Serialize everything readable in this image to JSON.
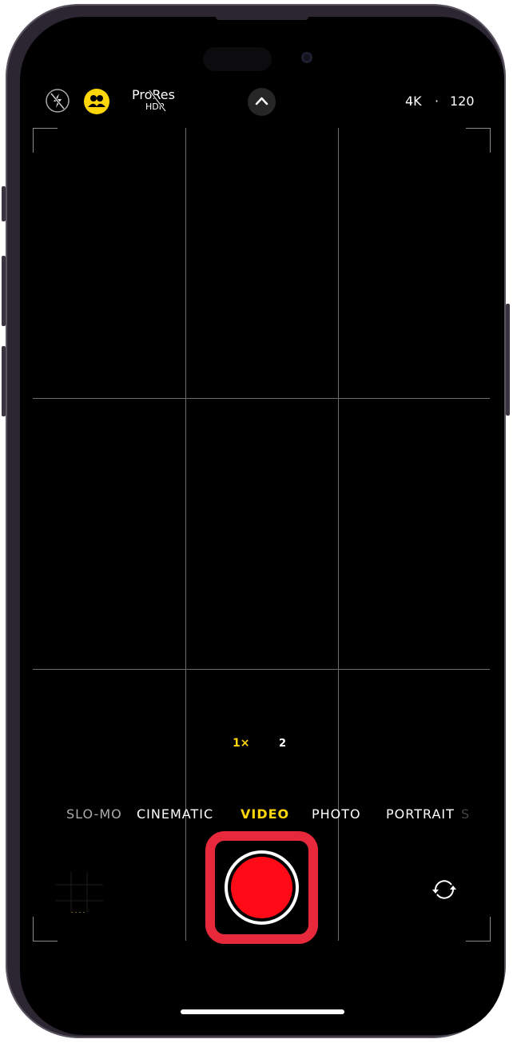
{
  "top_bar": {
    "flash": "flash-off-icon",
    "cinematic_icon": "people-icon",
    "prores_label": "ProRes",
    "hdr_label": "HDR",
    "resolution": "4K",
    "separator": "·",
    "frame_rate": "120"
  },
  "zoom": {
    "options": [
      "1×",
      "2"
    ],
    "selected": "1×"
  },
  "modes": {
    "items": [
      "SLO-MO",
      "CINEMATIC",
      "VIDEO",
      "PHOTO",
      "PORTRAIT",
      "S"
    ],
    "selected": "VIDEO"
  },
  "colors": {
    "accent": "#FFD60A",
    "record": "#FF0A16",
    "highlight": "#E8293C"
  }
}
